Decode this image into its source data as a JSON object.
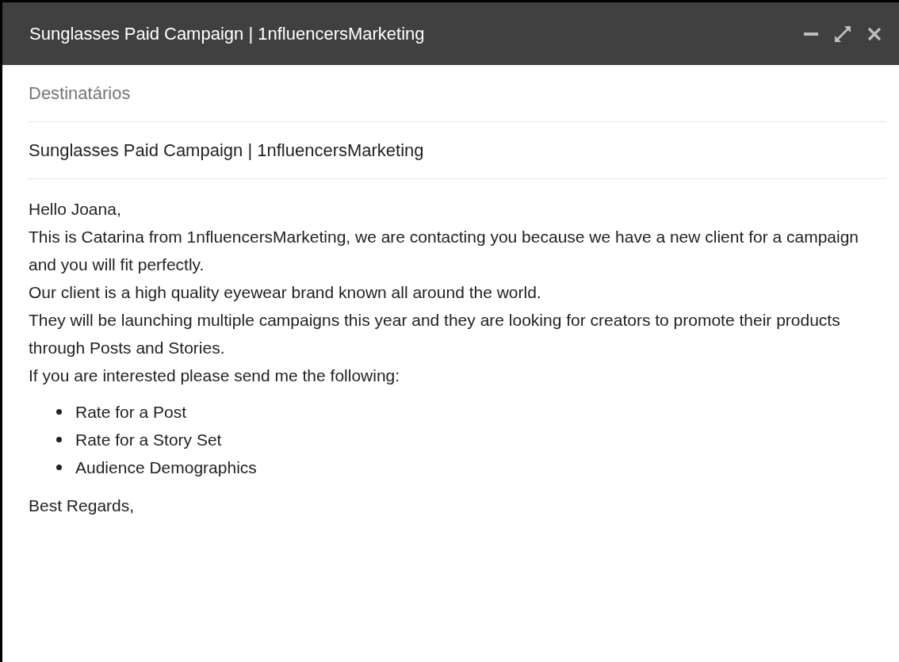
{
  "window": {
    "title": "Sunglasses Paid Campaign | 1nfluencersMarketing"
  },
  "recipients": {
    "placeholder": "Destinatários"
  },
  "subject": {
    "value": "Sunglasses Paid Campaign | 1nfluencersMarketing"
  },
  "body": {
    "paragraphs": [
      "Hello Joana,",
      "This is Catarina from 1nfluencersMarketing, we are contacting you because we have a new client for a campaign and you will fit perfectly.",
      "Our client is a high quality eyewear brand known all around the world.",
      "They will be launching multiple campaigns this year and they are looking for creators to promote their products through Posts and Stories.",
      "If you are interested please send me the following:"
    ],
    "list": [
      "Rate for a Post",
      "Rate for a Story Set",
      "Audience Demographics"
    ],
    "closing": "Best Regards,"
  }
}
